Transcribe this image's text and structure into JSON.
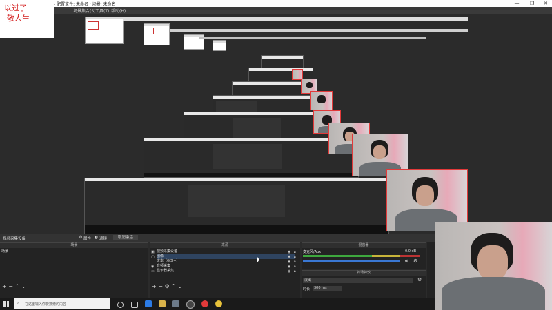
{
  "window": {
    "title": "- 配置文件: 未命名 · 场景: 未命名",
    "min_glyph": "—",
    "max_glyph": "❐",
    "close_glyph": "✕"
  },
  "menu": {
    "items": [
      "场景集合(S)",
      "工具(T)",
      "帮助(H)"
    ]
  },
  "logo": {
    "lines": [
      "以过了",
      "敬人生"
    ]
  },
  "source_bar": {
    "source_name": "视频采集设备",
    "properties_label": "属性",
    "filters_label": "滤镜",
    "deactivate_label": "取消激活"
  },
  "scenes_panel": {
    "header": "场景",
    "items": [
      "场景"
    ]
  },
  "sources_panel": {
    "header": "来源",
    "items": [
      "视频采集设备",
      "图像",
      "文本（GDI+）",
      "音频采集",
      "显示器采集"
    ]
  },
  "mixer_panel": {
    "header": "混音器",
    "track_name": "麦克风/Aux",
    "db_value": "0.0 dB"
  },
  "transition_panel": {
    "header": "转场特效",
    "selected": "淡出",
    "duration_label": "时长",
    "duration_value": "300 ms"
  },
  "taskbar": {
    "search_placeholder": "在这里输入你要搜索的内容"
  },
  "colors": {
    "accent_red": "#e23a3a",
    "meter_green": "#3ea83e",
    "meter_yellow": "#c8b43a",
    "slider_blue": "#3a78d4"
  },
  "icons": {
    "windows": "windows-start-icon",
    "gear": "gear-icon",
    "eye": "eye-icon",
    "lock": "lock-icon",
    "speaker": "speaker-icon",
    "add": "add-icon",
    "remove": "remove-icon",
    "up": "chevron-up-icon",
    "down": "chevron-down-icon"
  }
}
